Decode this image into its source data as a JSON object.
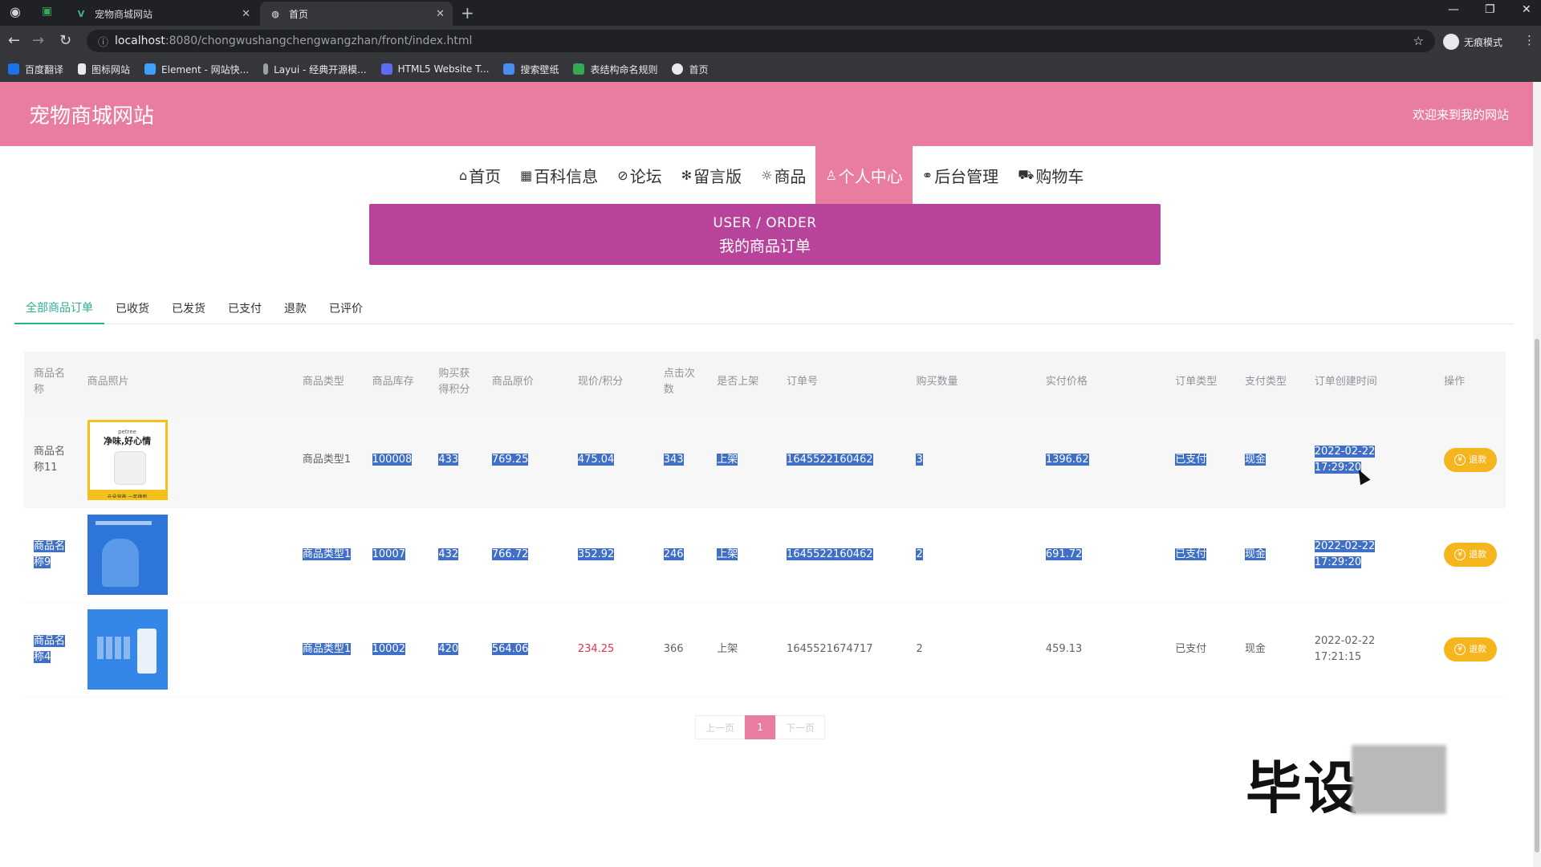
{
  "browser": {
    "tabs": [
      {
        "title": "宠物商城网站",
        "active": false
      },
      {
        "title": "首页",
        "active": true
      }
    ],
    "url_host": "localhost",
    "url_path": ":8080/chongwushangchengwangzhan/front/index.html",
    "profile_label": "无痕模式",
    "bookmarks": [
      "百度翻译",
      "图标网站",
      "Element - 网站快...",
      "Layui - 经典开源模...",
      "HTML5 Website T...",
      "搜索壁纸",
      "表结构命名规则",
      "首页"
    ]
  },
  "header": {
    "site_title": "宠物商城网站",
    "welcome": "欢迎来到我的网站"
  },
  "nav": {
    "items": [
      {
        "label": "首页",
        "icon": "home-icon",
        "glyph": "⌂"
      },
      {
        "label": "百科信息",
        "icon": "grid-icon",
        "glyph": "▦"
      },
      {
        "label": "论坛",
        "icon": "tag-icon",
        "glyph": "⊘"
      },
      {
        "label": "留言版",
        "icon": "snowflake-icon",
        "glyph": "✻"
      },
      {
        "label": "商品",
        "icon": "gift-icon",
        "glyph": "☼"
      },
      {
        "label": "个人中心",
        "icon": "user-icon",
        "glyph": "♙"
      },
      {
        "label": "后台管理",
        "icon": "link-icon",
        "glyph": "⚭"
      },
      {
        "label": "购物车",
        "icon": "cart-icon",
        "glyph": "⛟"
      }
    ],
    "active_index": 5
  },
  "banner": {
    "en": "USER / ORDER",
    "cn": "我的商品订单"
  },
  "order_tabs": {
    "items": [
      "全部商品订单",
      "已收货",
      "已发货",
      "已支付",
      "退款",
      "已评价"
    ],
    "active_index": 0
  },
  "table": {
    "headers": [
      "商品名称",
      "商品照片",
      "商品类型",
      "商品库存",
      "购买获得积分",
      "商品原价",
      "现价/积分",
      "点击次数",
      "是否上架",
      "订单号",
      "购买数量",
      "实付价格",
      "订单类型",
      "支付类型",
      "订单创建时间",
      "操作"
    ],
    "rows": [
      {
        "name": "商品名称11",
        "type": "商品类型1",
        "stock": "100008",
        "points": "433",
        "original_price": "769.25",
        "current_price": "475.04",
        "clicks": "343",
        "on_shelf": "上架",
        "order_no": "1645522160462",
        "quantity": "3",
        "paid": "1396.62",
        "order_type": "已支付",
        "pay_type": "现金",
        "created": "2022-02-22 17:29:20",
        "action": "退款"
      },
      {
        "name": "商品名称9",
        "type": "商品类型1",
        "stock": "10007",
        "points": "432",
        "original_price": "766.72",
        "current_price": "352.92",
        "clicks": "246",
        "on_shelf": "上架",
        "order_no": "1645522160462",
        "quantity": "2",
        "paid": "691.72",
        "order_type": "已支付",
        "pay_type": "现金",
        "created": "2022-02-22 17:29:20",
        "action": "退款"
      },
      {
        "name": "商品名称4",
        "type": "商品类型1",
        "stock": "10002",
        "points": "420",
        "original_price": "564.06",
        "current_price": "234.25",
        "clicks": "366",
        "on_shelf": "上架",
        "order_no": "1645521674717",
        "quantity": "2",
        "paid": "459.13",
        "order_type": "已支付",
        "pay_type": "现金",
        "created": "2022-02-22 17:21:15",
        "action": "退款"
      }
    ],
    "img1_brand": "petree",
    "img1_slogan": "净味,好心情",
    "img1_foot": "云朵宠养 一年换新"
  },
  "pager": {
    "prev": "上一页",
    "current": "1",
    "next": "下一页"
  },
  "watermark": "毕设",
  "colors": {
    "brand_pink": "#e87da0",
    "banner_purple": "#b8439a",
    "tab_active_green": "#2dae93",
    "refund_orange": "#f5b51d",
    "selection_blue": "#3f6fc7"
  }
}
